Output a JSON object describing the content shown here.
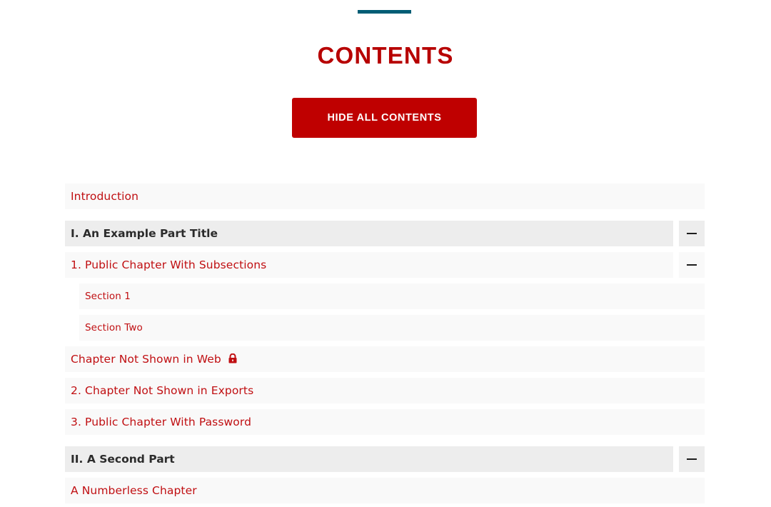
{
  "header": {
    "title": "CONTENTS",
    "toggle_button_label": "HIDE ALL CONTENTS"
  },
  "colors": {
    "accent_red": "#bf0000",
    "link_red": "#c00f12",
    "rule_teal": "#015d75",
    "part_bg": "#ededed",
    "entry_bg": "#f9f9f9"
  },
  "toc": {
    "introduction": "Introduction",
    "part1": {
      "title": "I. An Example Part Title",
      "collapse_icon": "minus-icon",
      "chapter1": {
        "title": "1. Public Chapter With Subsections",
        "collapse_icon": "minus-icon",
        "sections": [
          "Section 1",
          "Section Two"
        ]
      },
      "chapter_hidden": {
        "title": "Chapter Not Shown in Web",
        "icon": "lock-icon"
      },
      "chapter2": "2. Chapter Not Shown in Exports",
      "chapter3": "3. Public Chapter With Password"
    },
    "part2": {
      "title": "II. A Second Part",
      "collapse_icon": "minus-icon",
      "chapter_numberless": "A Numberless Chapter"
    }
  }
}
